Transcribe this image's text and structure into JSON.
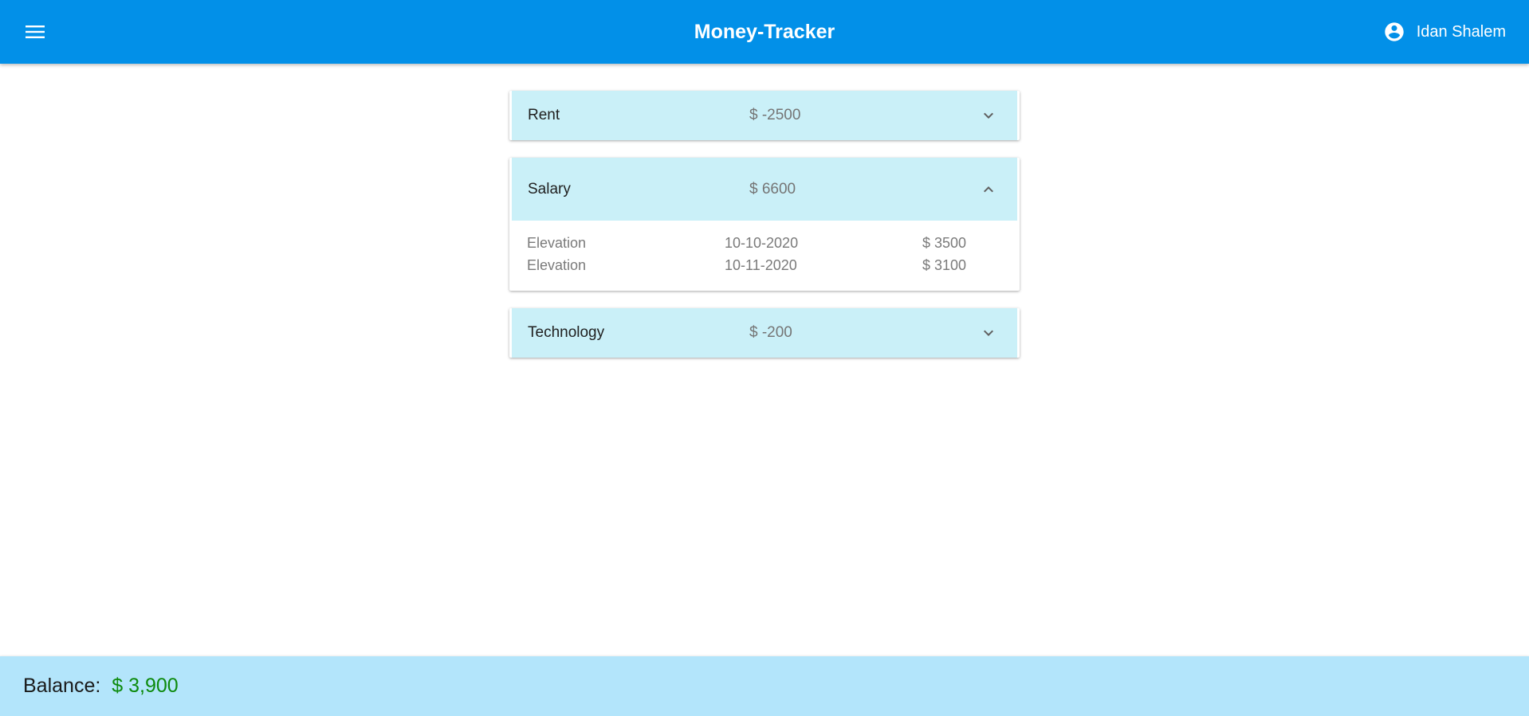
{
  "app": {
    "title": "Money-Tracker",
    "menu_icon": "menu-icon",
    "user_icon": "account-circle-icon",
    "user_name": "Idan Shalem"
  },
  "categories": [
    {
      "name": "Rent",
      "amount": "$ -2500",
      "expanded": false,
      "icon": "chevron-down-icon",
      "entries": []
    },
    {
      "name": "Salary",
      "amount": "$ 6600",
      "expanded": true,
      "icon": "chevron-up-icon",
      "entries": [
        {
          "source": "Elevation",
          "date": "10-10-2020",
          "amount": "$ 3500"
        },
        {
          "source": "Elevation",
          "date": "10-11-2020",
          "amount": "$ 3100"
        }
      ]
    },
    {
      "name": "Technology",
      "amount": "$ -200",
      "expanded": false,
      "icon": "chevron-down-icon",
      "entries": []
    }
  ],
  "balance": {
    "label": "Balance:",
    "value": "$ 3,900"
  },
  "colors": {
    "appbar": "#0290e8",
    "panel_header": "#caf0f8",
    "balance_bar": "#b3e5fb",
    "balance_value": "#0c8a0c"
  }
}
